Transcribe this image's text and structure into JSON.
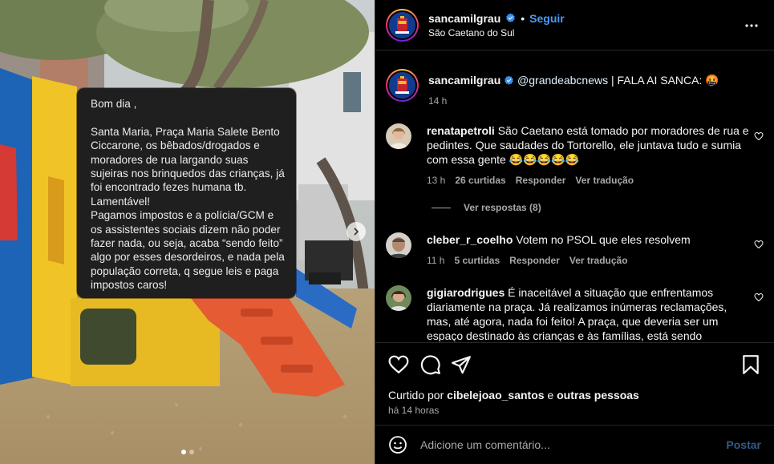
{
  "post": {
    "username": "sancamilgrau",
    "follow_label": "Seguir",
    "separator": "•",
    "location": "São Caetano do Sul"
  },
  "image": {
    "message_text": "Bom dia ,\n\nSanta Maria, Praça Maria Salete Bento Ciccarone, os bêbados/drogados e moradores de rua largando suas sujeiras nos brinquedos das crianças, já foi encontrado fezes humana tb. Lamentável!\nPagamos impostos e a polícia/GCM e os assistentes sociais dizem não poder fazer nada, ou seja, acaba “sendo feito” algo por esses desordeiros, e nada pela população correta, q segue leis e paga impostos caros!"
  },
  "caption": {
    "username": "sancamilgrau",
    "mention": "@grandeabcnews",
    "text": " | FALA AI SANCA: 🤬",
    "time": "14 h"
  },
  "comments": [
    {
      "username": "renatapetroli",
      "text": " São Caetano está tomado por moradores de rua e pedintes. Que saudades do Tortorello, ele juntava tudo e sumia com essa gente 😂😂😂😂😂",
      "time": "13 h",
      "likes": "26 curtidas",
      "reply": "Responder",
      "translate": "Ver tradução"
    },
    {
      "username": "cleber_r_coelho",
      "text": " Votem no PSOL que eles resolvem",
      "time": "11 h",
      "likes": "5 curtidas",
      "reply": "Responder",
      "translate": "Ver tradução"
    },
    {
      "username": "gigiarodrigues",
      "text": " É inaceitável a situação que enfrentamos diariamente na praça. Já realizamos inúmeras reclamações, mas, até agora, nada foi feito! A praça, que deveria ser um espaço destinado às crianças e às famílias, está sendo"
    }
  ],
  "replies_label": "Ver respostas (8)",
  "likes": {
    "prefix": "Curtido por ",
    "user": "cibelejoao_santos",
    "middle": " e ",
    "others": "outras pessoas",
    "time": "há 14 horas"
  },
  "compose": {
    "placeholder": "Adicione um comentário...",
    "post_label": "Postar"
  },
  "icons": {
    "more": "more-icon",
    "like": "heart-icon",
    "comment": "comment-icon",
    "share": "send-icon",
    "save": "bookmark-icon",
    "emoji": "emoji-icon",
    "carousel": "chevron-right-icon"
  },
  "colors": {
    "background": "#000000",
    "follow": "#4a9bf7",
    "muted": "#a8a8a8",
    "post_disabled": "#2f5d8a"
  }
}
